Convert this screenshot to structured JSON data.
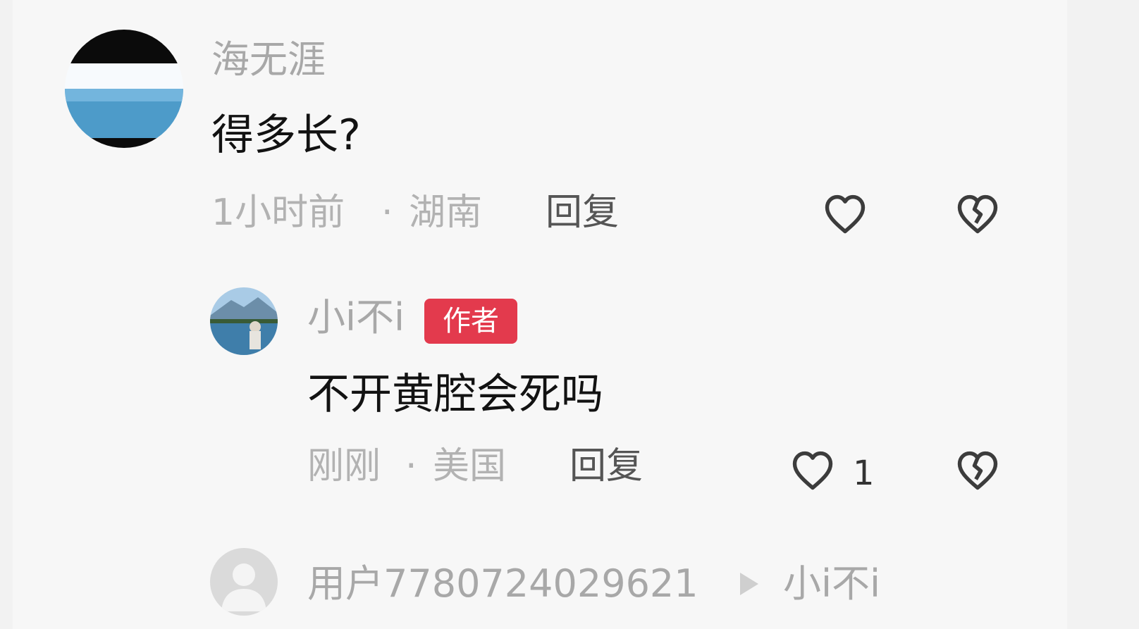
{
  "comment": {
    "username": "海无涯",
    "text": "得多长?",
    "time": "1小时前",
    "separator": "·",
    "location": "湖南",
    "reply_label": "回复"
  },
  "reply_comment": {
    "username": "小i不i",
    "badge": "作者",
    "text": "不开黄腔会死吗",
    "time": "刚刚",
    "separator": "·",
    "location": "美国",
    "reply_label": "回复",
    "like_count": "1"
  },
  "next_reply": {
    "username": "用户7780724029621",
    "target_username": "小i不i"
  },
  "icons": {
    "like": "heart-outline-icon",
    "dislike": "broken-heart-outline-icon",
    "reply_arrow": "play-arrow-icon"
  },
  "colors": {
    "badge": "#e33a4d",
    "username": "#a8a8a8",
    "meta": "#b2b2b2",
    "comment_text": "#121212"
  }
}
